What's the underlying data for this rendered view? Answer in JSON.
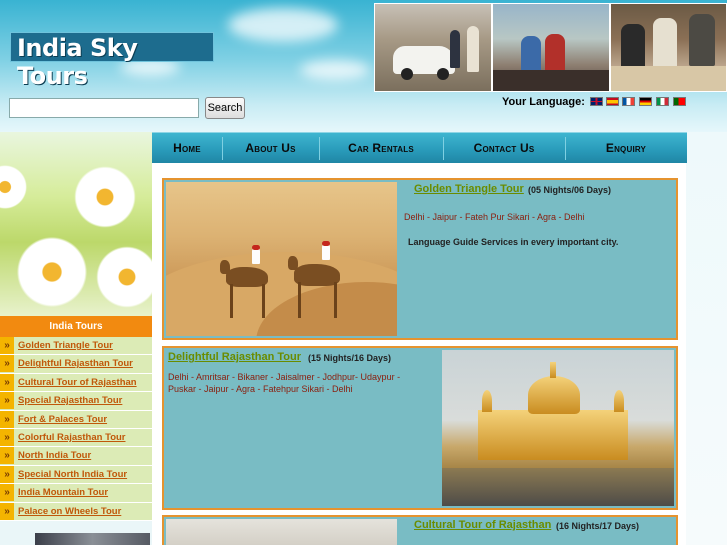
{
  "header": {
    "logo_text": "India Sky Tours",
    "search": {
      "value": "",
      "button_label": "Search"
    },
    "language_label": "Your Language:",
    "languages": [
      "english",
      "spanish",
      "french",
      "german",
      "italian",
      "portuguese"
    ]
  },
  "nav": {
    "items": [
      "Home",
      "About Us",
      "Car Rentals",
      "Contact Us",
      "Enquiry"
    ]
  },
  "sidebar": {
    "heading": "India Tours",
    "bullet": "»",
    "items": [
      "Golden Triangle Tour",
      "Delightful Rajasthan Tour",
      "Cultural Tour of Rajasthan",
      "Special Rajasthan Tour",
      "Fort & Palaces Tour",
      "Colorful Rajasthan Tour",
      "North India Tour",
      "Special North India Tour",
      "India Mountain Tour",
      "Palace on Wheels Tour"
    ]
  },
  "tours": [
    {
      "title": "Golden Triangle Tour",
      "duration": "(05 Nights/06 Days)",
      "route": "Delhi - Jaipur - Fateh Pur Sikari - Agra - Delhi",
      "note": "Language Guide Services in every important city."
    },
    {
      "title": "Delightful Rajasthan Tour",
      "duration": "(15 Nights/16 Days)",
      "route_line1": "Delhi - Amritsar - Bikaner - Jaisalmer - Jodhpur- Udaypur -",
      "route_line2": "Puskar - Jaipur - Agra - Fatehpur Sikari - Delhi"
    },
    {
      "title": "Cultural Tour of Rajasthan",
      "duration": "(16 Nights/17 Days)"
    }
  ],
  "colors": {
    "nav_bar": "#2a9cbb",
    "accent_orange": "#f28a10",
    "tour_box_bg": "#79bcc4",
    "tour_box_border": "#e5932f",
    "title_green": "#6a8c00",
    "route_red": "#8a2010",
    "sidebar_link": "#c0580a"
  }
}
